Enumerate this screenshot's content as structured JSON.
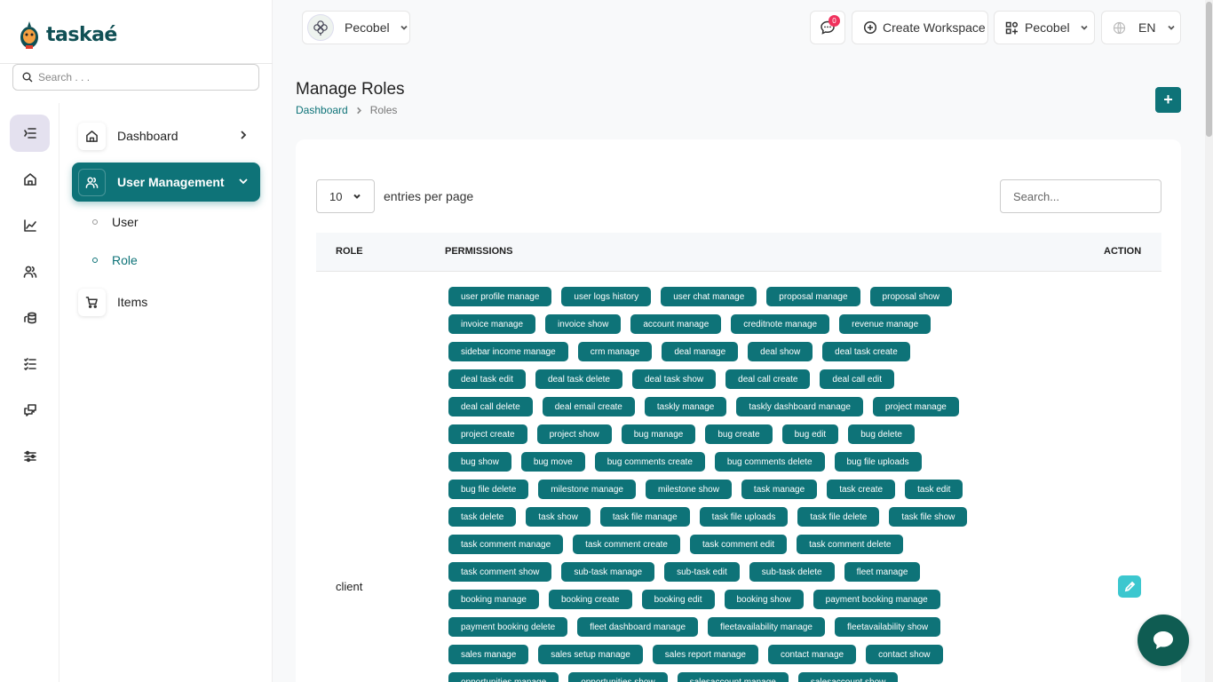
{
  "app": {
    "name": "taskaé"
  },
  "search": {
    "placeholder": "Search . . ."
  },
  "topbar": {
    "workspace_name": "Pecobel",
    "notification_count": "0",
    "create_workspace_label": "Create Workspace",
    "workspace_menu_label": "Pecobel",
    "language": "EN"
  },
  "rail": {
    "items": [
      {
        "icon": "menu-collapse-icon",
        "active": true
      },
      {
        "icon": "home-icon"
      },
      {
        "icon": "chart-icon"
      },
      {
        "icon": "users-icon"
      },
      {
        "icon": "coins-icon"
      },
      {
        "icon": "checklist-icon"
      },
      {
        "icon": "chat-icon"
      },
      {
        "icon": "sliders-icon"
      }
    ]
  },
  "sidebar": {
    "dashboard_label": "Dashboard",
    "user_management_label": "User Management",
    "user_label": "User",
    "role_label": "Role",
    "items_label": "Items"
  },
  "page": {
    "title": "Manage Roles",
    "breadcrumb_home": "Dashboard",
    "breadcrumb_current": "Roles",
    "add_button_label": "+"
  },
  "table": {
    "entries_value": "10",
    "entries_label": "entries per page",
    "search_placeholder": "Search...",
    "columns": {
      "role": "ROLE",
      "permissions": "PERMISSIONS",
      "action": "ACTION"
    },
    "rows": [
      {
        "role": "client",
        "permissions": [
          "user profile manage",
          "user logs history",
          "user chat manage",
          "proposal manage",
          "proposal show",
          "invoice manage",
          "invoice show",
          "account manage",
          "creditnote manage",
          "revenue manage",
          "sidebar income manage",
          "crm manage",
          "deal manage",
          "deal show",
          "deal task create",
          "deal task edit",
          "deal task delete",
          "deal task show",
          "deal call create",
          "deal call edit",
          "deal call delete",
          "deal email create",
          "taskly manage",
          "taskly dashboard manage",
          "project manage",
          "project create",
          "project show",
          "bug manage",
          "bug create",
          "bug edit",
          "bug delete",
          "bug show",
          "bug move",
          "bug comments create",
          "bug comments delete",
          "bug file uploads",
          "bug file delete",
          "milestone manage",
          "milestone show",
          "task manage",
          "task create",
          "task edit",
          "task delete",
          "task show",
          "task file manage",
          "task file uploads",
          "task file delete",
          "task file show",
          "task comment manage",
          "task comment create",
          "task comment edit",
          "task comment delete",
          "task comment show",
          "sub-task manage",
          "sub-task edit",
          "sub-task delete",
          "fleet manage",
          "booking manage",
          "booking create",
          "booking edit",
          "booking show",
          "payment booking manage",
          "payment booking delete",
          "fleet dashboard manage",
          "fleetavailability manage",
          "fleetavailability show",
          "sales manage",
          "sales setup manage",
          "sales report manage",
          "contact manage",
          "contact show",
          "opportunities manage",
          "opportunities show",
          "salesaccount manage",
          "salesaccount show"
        ]
      }
    ]
  },
  "colors": {
    "accent": "#0e7378",
    "edit": "#3cc7cf",
    "badge": "#f0325d"
  }
}
